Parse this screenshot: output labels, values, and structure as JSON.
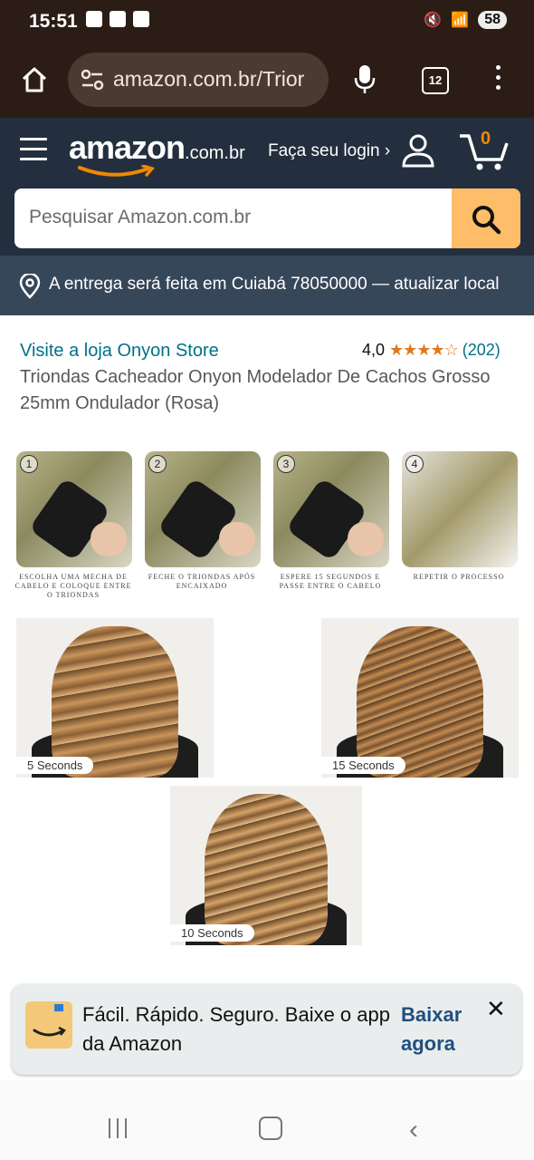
{
  "status_bar": {
    "time": "15:51",
    "battery": "58"
  },
  "browser": {
    "url": "amazon.com.br/Trior",
    "tab_count": "12"
  },
  "header": {
    "logo_main": "amazon",
    "logo_tld": ".com.br",
    "login_label": "Faça seu login ›",
    "cart_count": "0",
    "search_placeholder": "Pesquisar Amazon.com.br"
  },
  "delivery": {
    "text": "A entrega será feita em Cuiabá 78050000 — atualizar local"
  },
  "product": {
    "store_link": "Visite a loja Onyon Store",
    "rating_value": "4,0",
    "rating_stars": 4.0,
    "rating_stars_text": "★★★★☆",
    "rating_count": "(202)",
    "title": "Triondas Cacheador Onyon Modelador De Cachos Grosso 25mm Ondulador (Rosa)"
  },
  "steps": [
    {
      "num": "1",
      "caption": "ESCOLHA UMA MECHA DE CABELO E COLOQUE ENTRE O TRIONDAS"
    },
    {
      "num": "2",
      "caption": "FECHE O TRIONDAS APÓS ENCAIXADO"
    },
    {
      "num": "3",
      "caption": "ESPERE 15 SEGUNDOS E PASSE ENTRE O CABELO"
    },
    {
      "num": "4",
      "caption": "REPETIR O PROCESSO"
    }
  ],
  "results": {
    "five": "5 Seconds",
    "fifteen": "15 Seconds",
    "ten": "10 Seconds"
  },
  "app_banner": {
    "text": "Fácil. Rápido. Seguro. Baixe o app da Amazon",
    "cta": "Baixar agora",
    "close": "✕"
  }
}
